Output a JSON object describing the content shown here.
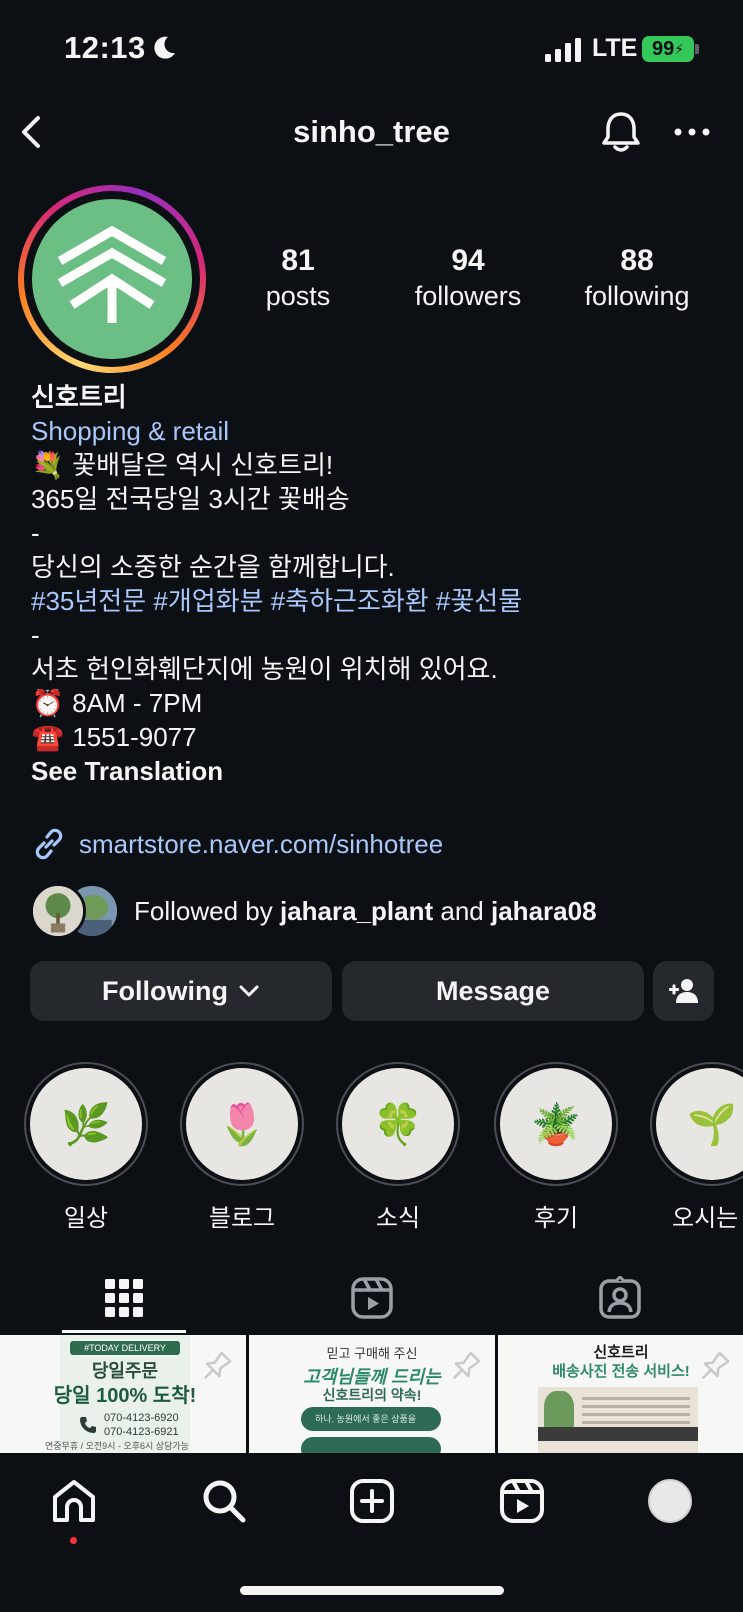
{
  "status_bar": {
    "time": "12:13",
    "network": "LTE",
    "battery": "99"
  },
  "header": {
    "username": "sinho_tree"
  },
  "stats": {
    "posts": {
      "value": "81",
      "label": "posts"
    },
    "followers": {
      "value": "94",
      "label": "followers"
    },
    "following": {
      "value": "88",
      "label": "following"
    }
  },
  "bio": {
    "name": "신호트리",
    "category": "Shopping & retail",
    "lines": {
      "l1_emoji": "💐",
      "l1": "꽃배달은 역시 신호트리!",
      "l2": "365일 전국당일 3시간 꽃배송",
      "l3": "-",
      "l4": "당신의 소중한 순간을 함께합니다.",
      "hashtags": "#35년전문 #개업화분 #축하근조화환 #꽃선물",
      "l6": "-",
      "l7": "서초 헌인화훼단지에 농원이 위치해 있어요.",
      "hours_emoji": "⏰",
      "hours": "8AM - 7PM",
      "phone_emoji": "☎️",
      "phone": "1551-9077"
    },
    "see_translation": "See Translation"
  },
  "link": {
    "text": "smartstore.naver.com/sinhotree"
  },
  "followed_by": {
    "prefix": "Followed by",
    "user1": "jahara_plant",
    "joiner": "and",
    "user2": "jahara08"
  },
  "actions": {
    "following": "Following",
    "message": "Message"
  },
  "highlights": [
    {
      "label": "일상",
      "emoji": "🌿"
    },
    {
      "label": "블로그",
      "emoji": "🌷"
    },
    {
      "label": "소식",
      "emoji": "🍀"
    },
    {
      "label": "후기",
      "emoji": "🪴"
    },
    {
      "label": "오시는 길",
      "emoji": "🌱"
    }
  ],
  "posts": [
    {
      "tag": "#TODAY DELIVERY",
      "line1": "당일주문",
      "line2": "당일 100% 도착!",
      "phone1": "070-4123-6920",
      "phone2": "070-4123-6921",
      "note": "연중무휴 / 오전9시 - 오후6시 상담가능"
    },
    {
      "line1": "믿고 구매해 주신",
      "line2": "고객님들께 드리는",
      "line3": "신호트리의 약속!",
      "pill": "하나. 농원에서 좋은 상품을"
    },
    {
      "line1": "신호트리",
      "line2": "배송사진 전송 서비스!"
    }
  ],
  "colors": {
    "background": "#0c1014",
    "link": "#a8c7fa",
    "button": "#25292e",
    "avatar_green": "#6cbf84",
    "notification_dot": "#ff3040"
  }
}
